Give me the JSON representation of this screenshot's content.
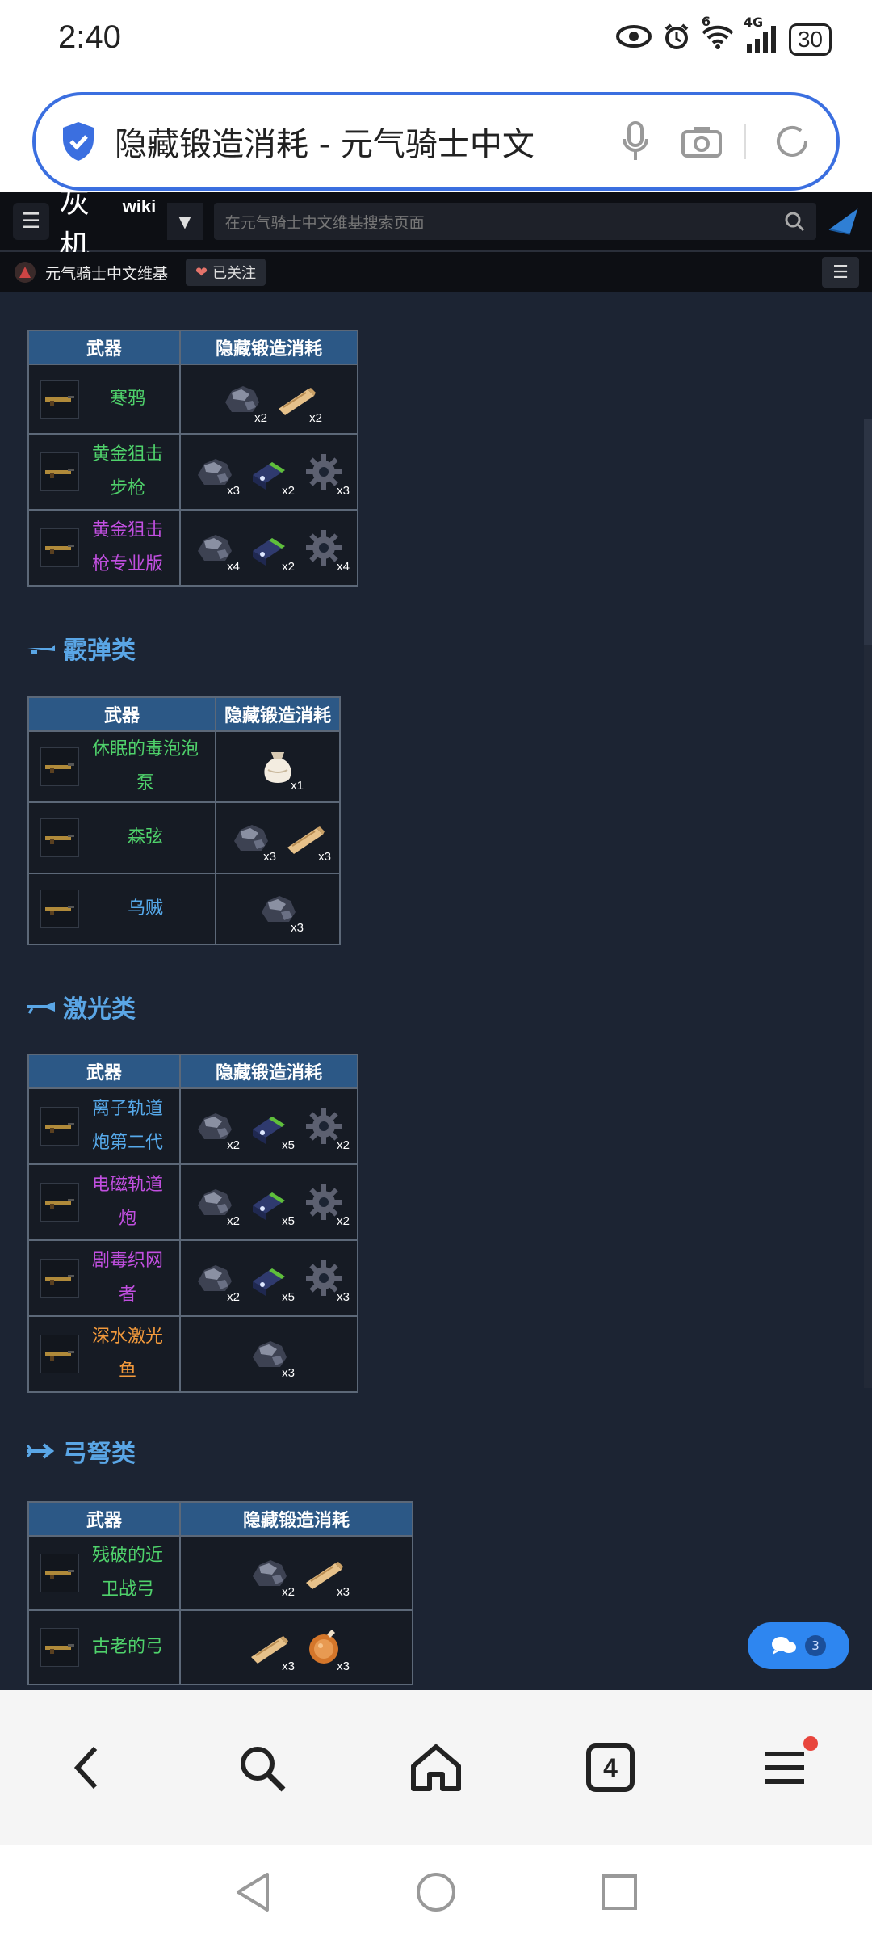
{
  "status": {
    "time": "2:40",
    "network": "4G",
    "signal_badge": "6",
    "battery": "30"
  },
  "browser": {
    "url_text": "隐藏锻造消耗 - 元气骑士中文"
  },
  "wiki_header": {
    "logo_text": "灰机",
    "logo_wiki": "wiki",
    "search_placeholder": "在元气骑士中文维基搜索页面",
    "site_name": "元气骑士中文维基",
    "follow_label": "已关注"
  },
  "table_headers": {
    "weapon": "武器",
    "cost": "隐藏锻造消耗"
  },
  "sections": {
    "shotgun": "霰弹类",
    "laser": "激光类",
    "bow": "弓弩类"
  },
  "sniper_rows": [
    {
      "name": "寒鸦",
      "color": "green",
      "mats": [
        {
          "type": "ore",
          "count": "x2"
        },
        {
          "type": "wood",
          "count": "x2"
        }
      ]
    },
    {
      "name": "黄金狙击步枪",
      "color": "green",
      "mats": [
        {
          "type": "ore",
          "count": "x3"
        },
        {
          "type": "battery",
          "count": "x2"
        },
        {
          "type": "gear",
          "count": "x3"
        }
      ]
    },
    {
      "name": "黄金狙击枪专业版",
      "color": "purple",
      "mats": [
        {
          "type": "ore",
          "count": "x4"
        },
        {
          "type": "battery",
          "count": "x2"
        },
        {
          "type": "gear",
          "count": "x4"
        }
      ]
    }
  ],
  "shotgun_rows": [
    {
      "name": "休眠的毒泡泡泵",
      "color": "green",
      "mats": [
        {
          "type": "bag",
          "count": "x1"
        }
      ]
    },
    {
      "name": "森弦",
      "color": "green",
      "mats": [
        {
          "type": "ore",
          "count": "x3"
        },
        {
          "type": "wood",
          "count": "x3"
        }
      ]
    },
    {
      "name": "乌贼",
      "color": "blue",
      "mats": [
        {
          "type": "ore",
          "count": "x3"
        }
      ]
    }
  ],
  "laser_rows": [
    {
      "name": "离子轨道炮第二代",
      "color": "blue",
      "mats": [
        {
          "type": "ore",
          "count": "x2"
        },
        {
          "type": "battery",
          "count": "x5"
        },
        {
          "type": "gear",
          "count": "x2"
        }
      ]
    },
    {
      "name": "电磁轨道炮",
      "color": "purple",
      "mats": [
        {
          "type": "ore",
          "count": "x2"
        },
        {
          "type": "battery",
          "count": "x5"
        },
        {
          "type": "gear",
          "count": "x2"
        }
      ]
    },
    {
      "name": "剧毒织网者",
      "color": "purple",
      "mats": [
        {
          "type": "ore",
          "count": "x2"
        },
        {
          "type": "battery",
          "count": "x5"
        },
        {
          "type": "gear",
          "count": "x3"
        }
      ]
    },
    {
      "name": "深水激光鱼",
      "color": "orange",
      "mats": [
        {
          "type": "ore",
          "count": "x3"
        }
      ]
    }
  ],
  "bow_rows": [
    {
      "name": "残破的近卫战弓",
      "color": "green",
      "mats": [
        {
          "type": "ore",
          "count": "x2"
        },
        {
          "type": "wood",
          "count": "x3"
        }
      ]
    },
    {
      "name": "古老的弓",
      "color": "green",
      "mats": [
        {
          "type": "wood",
          "count": "x3"
        },
        {
          "type": "meat",
          "count": "x3"
        }
      ]
    }
  ],
  "chat": {
    "count": "3"
  },
  "bottom_nav": {
    "tab_count": "4"
  },
  "colors": {
    "accent": "#3b6fe0",
    "header_cell": "#2c5886",
    "page_bg": "#1c2433"
  }
}
